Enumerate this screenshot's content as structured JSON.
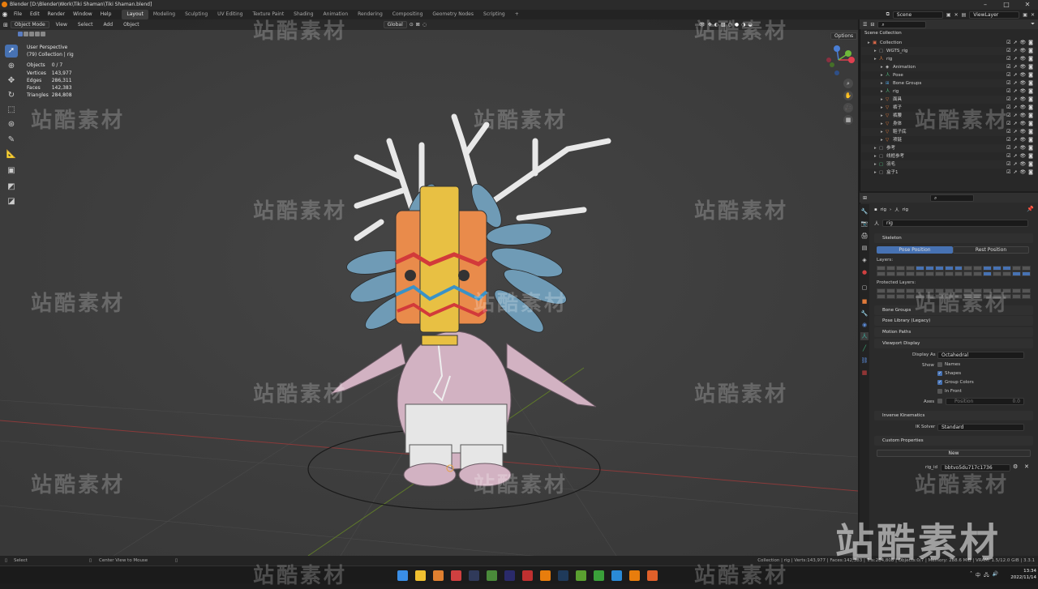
{
  "title_bar": {
    "title": "Blender [D:\\Blender\\Work\\Tiki Shaman\\Tiki Shaman.blend]"
  },
  "menu": [
    "File",
    "Edit",
    "Render",
    "Window",
    "Help"
  ],
  "workspaces": [
    "Layout",
    "Modeling",
    "Sculpting",
    "UV Editing",
    "Texture Paint",
    "Shading",
    "Animation",
    "Rendering",
    "Compositing",
    "Geometry Nodes",
    "Scripting"
  ],
  "active_workspace": "Layout",
  "scene": {
    "scene_name": "Scene",
    "view_layer": "ViewLayer"
  },
  "viewport_header": {
    "mode": "Object Mode",
    "menus": [
      "View",
      "Select",
      "Add",
      "Object"
    ],
    "orientation": "Global",
    "options": "Options"
  },
  "viewport_overlay": {
    "view_name": "User Perspective",
    "collection": "(79) Collection | rig",
    "stats": [
      {
        "label": "Objects",
        "value": "0 / 7"
      },
      {
        "label": "Vertices",
        "value": "143,977"
      },
      {
        "label": "Edges",
        "value": "286,311"
      },
      {
        "label": "Faces",
        "value": "142,383"
      },
      {
        "label": "Triangles",
        "value": "284,808"
      }
    ]
  },
  "outliner": {
    "root": "Scene Collection",
    "rows": [
      {
        "name": "Collection",
        "indent": 1
      },
      {
        "name": "WGTS_rig",
        "indent": 2
      },
      {
        "name": "rig",
        "indent": 2
      },
      {
        "name": "Animation",
        "indent": 3
      },
      {
        "name": "Pose",
        "indent": 3
      },
      {
        "name": "Bone Groups",
        "indent": 3
      },
      {
        "name": "rig",
        "indent": 3
      },
      {
        "name": "面具",
        "indent": 3
      },
      {
        "name": "裤子",
        "indent": 3
      },
      {
        "name": "裤腰",
        "indent": 3
      },
      {
        "name": "身体",
        "indent": 3
      },
      {
        "name": "鞋子底",
        "indent": 3
      },
      {
        "name": "项链",
        "indent": 3
      },
      {
        "name": "参考",
        "indent": 2
      },
      {
        "name": "线框参考",
        "indent": 2
      },
      {
        "name": "羽毛",
        "indent": 2
      },
      {
        "name": "盒子1",
        "indent": 2
      }
    ]
  },
  "properties": {
    "breadcrumb": [
      "rig",
      "rig"
    ],
    "object_name": "rig",
    "sections": {
      "skeleton": "Skeleton",
      "pose_position": "Pose Position",
      "rest_position": "Rest Position",
      "layers": "Layers:",
      "protected_layers": "Protected Layers:",
      "bone_groups": "Bone Groups",
      "pose_library": "Pose Library (Legacy)",
      "motion_paths": "Motion Paths",
      "viewport_display": "Viewport Display",
      "display_as_label": "Display As",
      "display_as_value": "Octahedral",
      "show_label": "Show",
      "names": "Names",
      "shapes": "Shapes",
      "group_colors": "Group Colors",
      "in_front": "In Front",
      "axes_label": "Axes",
      "axes_position": "Position",
      "axes_value": "0.0",
      "inverse_kinematics": "Inverse Kinematics",
      "ik_solver_label": "IK Solver",
      "ik_solver_value": "Standard",
      "custom_properties": "Custom Properties",
      "new_button": "New",
      "rig_id_label": "rig_id",
      "rig_id_value": "bbtvo5du717c1736"
    }
  },
  "status_bar": {
    "left_action": "Select",
    "middle_action": "Center View to Mouse",
    "right_info": "Collection | rig | Verts:143,977 | Faces:142,383 | Tris:284,808 | Objects:0/7 | Memory: 288.6 MiB | VRAM: 1.5/12.0 GiB | 3.3.1"
  },
  "taskbar": {
    "time": "13:34",
    "date": "2022/11/14",
    "app_icons": [
      "windows-icon",
      "explorer-icon",
      "search-icon",
      "illustrator-icon",
      "painter-icon",
      "photoshop-icon",
      "premiere-icon",
      "acrobat-icon",
      "blender-icon",
      "ps-icon",
      "nvidia-icon",
      "wechat-icon",
      "edge-icon",
      "blender-active-icon",
      "vlc-icon"
    ]
  },
  "watermark_text": "站酷素材"
}
